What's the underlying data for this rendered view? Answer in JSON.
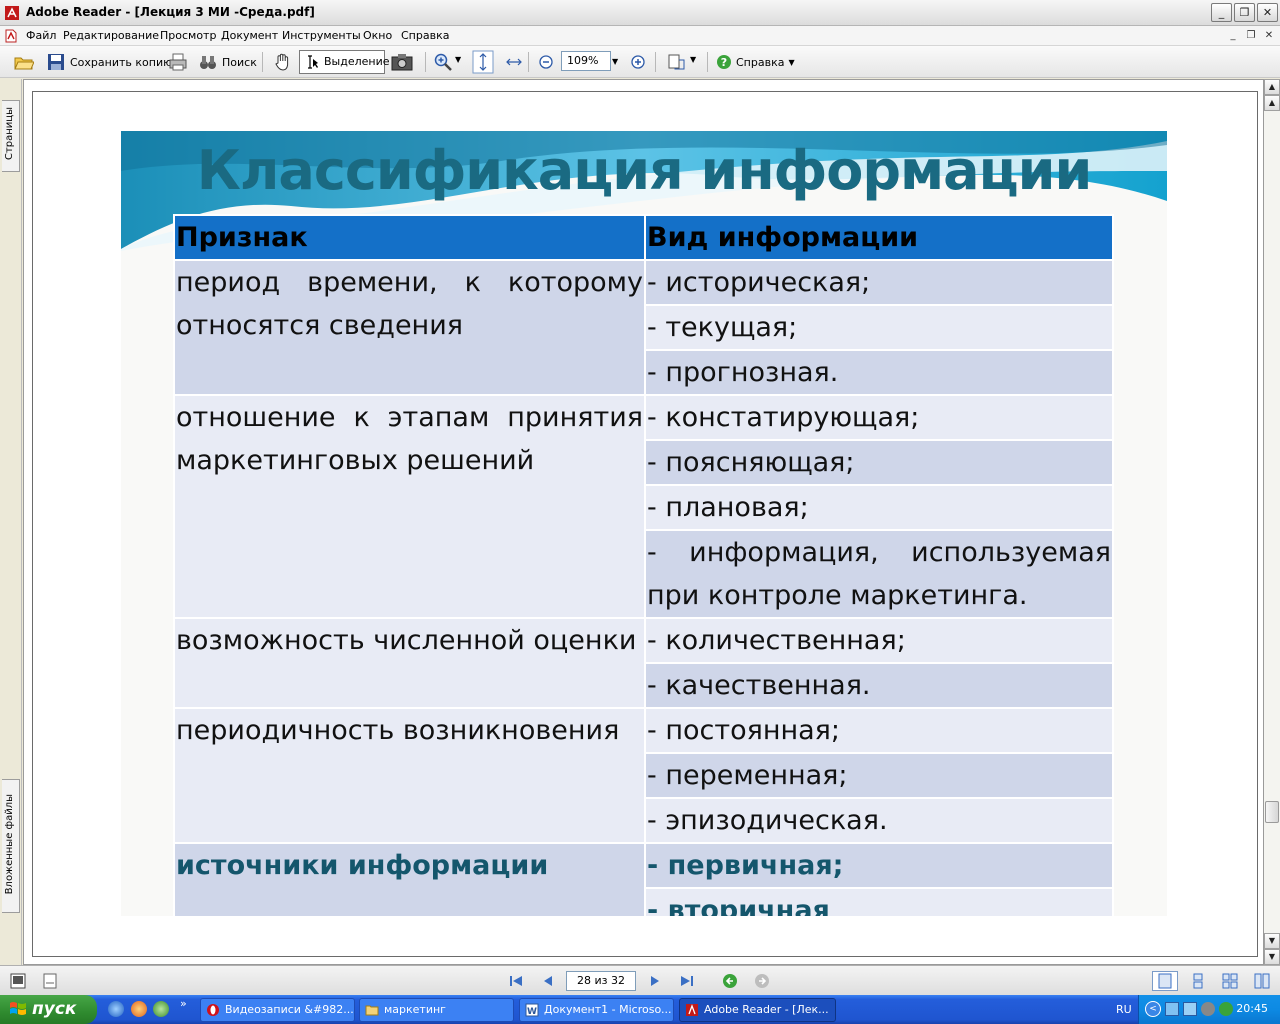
{
  "window": {
    "title": "Adobe Reader - [Лекция 3 МИ -Среда.pdf]",
    "controls": [
      "_",
      "❐",
      "✕"
    ]
  },
  "menu": {
    "items": [
      "Файл",
      "Редактирование",
      "Просмотр",
      "Документ",
      "Инструменты",
      "Окно",
      "Справка"
    ]
  },
  "toolbar": {
    "save_copy": "Сохранить копию",
    "search": "Поиск",
    "select": "Выделение",
    "zoom": "109%",
    "help": "Справка"
  },
  "sidebar": {
    "pages_tab": "Страницы",
    "attachments_tab": "Вложенные файлы"
  },
  "slide": {
    "title": "Классификация информации",
    "header": {
      "criterion": "Признак",
      "type": "Вид информации"
    },
    "rows": [
      {
        "criterion": "период времени, к которому относятся сведения",
        "types": [
          "- историческая;",
          "- текущая;",
          "- прогнозная."
        ]
      },
      {
        "criterion": "отношение к этапам принятия маркетинговых решений",
        "types": [
          "- констатирующая;",
          "- поясняющая;",
          "- плановая;",
          "- информация, используемая при контроле маркетинга."
        ]
      },
      {
        "criterion": "возможность численной оценки",
        "types": [
          "- количественная;",
          "- качественная."
        ]
      },
      {
        "criterion": "периодичность возникновения",
        "types": [
          "- постоянная;",
          "- переменная;",
          "- эпизодическая."
        ]
      },
      {
        "criterion": "источники информации",
        "types": [
          "- первичная;",
          "- вторичная"
        ]
      }
    ]
  },
  "navigation": {
    "page_indicator": "28 из 32"
  },
  "taskbar": {
    "start": "пуск",
    "tasks": [
      "Видеозаписи &#982...",
      "маркетинг",
      "Документ1 - Microso...",
      "Adobe Reader - [Лек..."
    ],
    "language": "RU",
    "clock": "20:45"
  }
}
